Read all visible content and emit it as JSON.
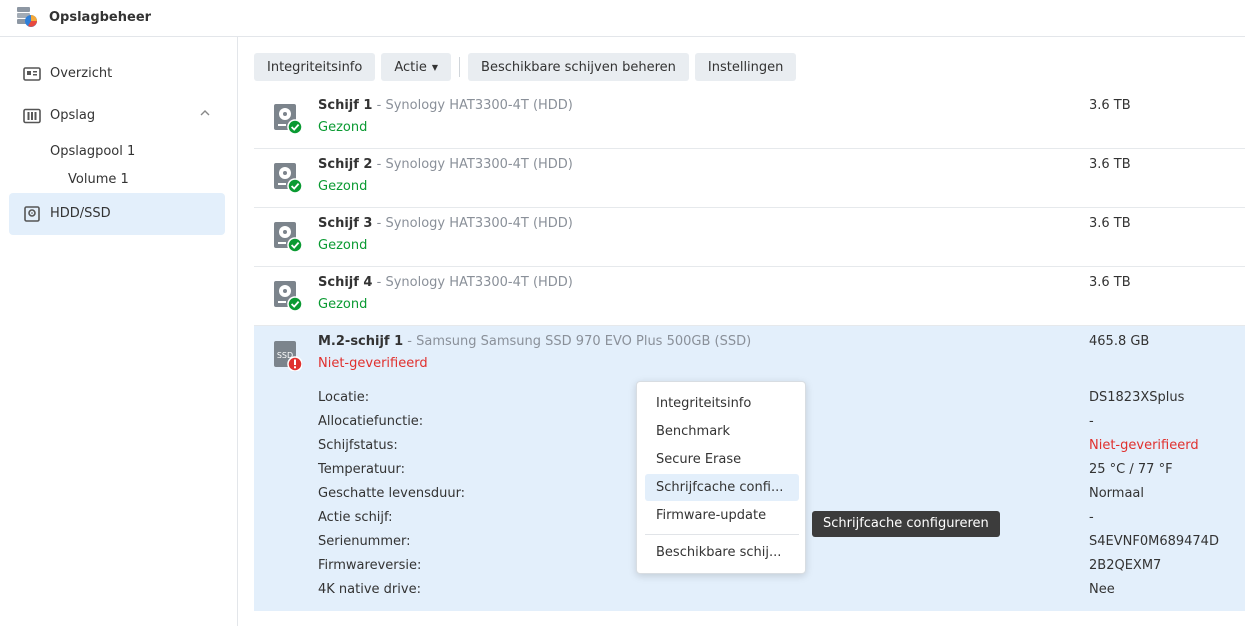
{
  "app": {
    "title": "Opslagbeheer",
    "icon": "storage-manager-icon"
  },
  "sidebar": {
    "overview": {
      "label": "Overzicht",
      "icon": "overview-icon"
    },
    "storage": {
      "label": "Opslag",
      "icon": "storage-icon",
      "expanded": true
    },
    "pool": {
      "label": "Opslagpool 1"
    },
    "volume": {
      "label": "Volume 1"
    },
    "hddssd": {
      "label": "HDD/SSD",
      "icon": "disk-icon",
      "active": true
    }
  },
  "toolbar": {
    "integrity": "Integriteitsinfo",
    "action": "Actie",
    "manage": "Beschikbare schijven beheren",
    "settings": "Instellingen"
  },
  "disks": [
    {
      "name": "Schijf 1",
      "model": "Synology HAT3300-4T (HDD)",
      "status": "Gezond",
      "size": "3.6 TB"
    },
    {
      "name": "Schijf 2",
      "model": "Synology HAT3300-4T (HDD)",
      "status": "Gezond",
      "size": "3.6 TB"
    },
    {
      "name": "Schijf 3",
      "model": "Synology HAT3300-4T (HDD)",
      "status": "Gezond",
      "size": "3.6 TB"
    },
    {
      "name": "Schijf 4",
      "model": "Synology HAT3300-4T (HDD)",
      "status": "Gezond",
      "size": "3.6 TB"
    }
  ],
  "ssd": {
    "name": "M.2-schijf 1",
    "model": "Samsung Samsung SSD 970 EVO Plus 500GB (SSD)",
    "status": "Niet-geverifieerd",
    "size": "465.8 GB",
    "icon_text": "SSD",
    "details": [
      {
        "label": "Locatie:",
        "value": "DS1823XSplus"
      },
      {
        "label": "Allocatiefunctie:",
        "value": "-"
      },
      {
        "label": "Schijfstatus:",
        "value": "Niet-geverifieerd"
      },
      {
        "label": "Temperatuur:",
        "value": "25 °C / 77 °F"
      },
      {
        "label": "Geschatte levensduur:",
        "value": "Normaal"
      },
      {
        "label": "Actie schijf:",
        "value": "-"
      },
      {
        "label": "Serienummer:",
        "value": "S4EVNF0M689474D"
      },
      {
        "label": "Firmwareversie:",
        "value": "2B2QEXM7"
      },
      {
        "label": "4K native drive:",
        "value": "Nee"
      }
    ]
  },
  "context_menu": {
    "items": [
      "Integriteitsinfo",
      "Benchmark",
      "Secure Erase",
      "Schrijfcache confi...",
      "Firmware-update",
      "Beschikbare schij..."
    ]
  },
  "tooltip": "Schrijfcache configureren",
  "separator": " - ",
  "colors": {
    "healthy": "#0a9a32",
    "warning": "#e0302e",
    "selected": "#e3effb"
  }
}
